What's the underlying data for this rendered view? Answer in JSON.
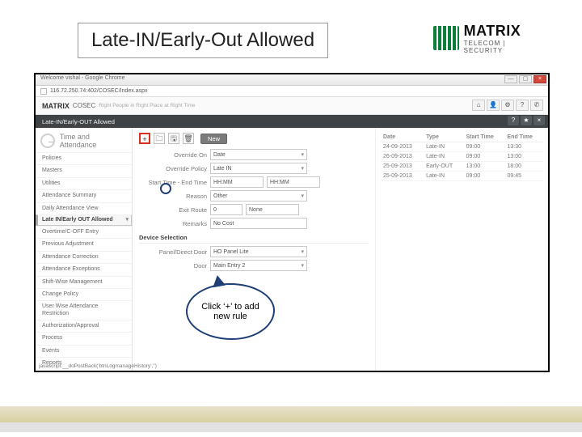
{
  "slide": {
    "title": "Late-IN/Early-Out Allowed"
  },
  "logo": {
    "text": "MATRIX",
    "sub": "TELECOM | SECURITY"
  },
  "browser": {
    "title": "Welcome vishal - Google Chrome",
    "url": "116.72.250.74:402/COSEC/Index.aspx"
  },
  "app": {
    "brand": "MATRIX",
    "product": "COSEC",
    "tagline": "Right People in Right Place at Right Time",
    "crumb": "Late-IN/Early-OUT Allowed",
    "header_icons": {
      "home": "⌂",
      "person": "👤",
      "gear": "⚙",
      "help": "?",
      "phone": "✆"
    },
    "crumb_icons": {
      "help": "?",
      "star": "★",
      "close": "×"
    }
  },
  "sidebar": {
    "module": "Time and Attendance",
    "groups": [
      "Policies",
      "Masters",
      "Utilities"
    ],
    "items": [
      "Attendance Summary",
      "Daily Attendance View",
      "Late IN/Early OUT Allowed",
      "Overtime/C-OFF Entry",
      "Previous Adjustment",
      "Attendance Correction",
      "Attendance Exceptions",
      "Shift-Wise Management",
      "Change Policy",
      "User Wise Attendance Restriction"
    ],
    "tail": [
      "Authorization/Approval",
      "Process",
      "Events",
      "Reports"
    ]
  },
  "toolbar": {
    "plus": "+",
    "open": "🗀",
    "save": "🖫",
    "trash": "🗑",
    "new_label": "New"
  },
  "form": {
    "override_on_l": "Override On",
    "override_on_v": "Date",
    "override_policy_l": "Override Policy",
    "override_policy_v": "Late IN",
    "time_l": "Start Time - End Time",
    "start_v": "HH:MM",
    "end_v": "HH:MM",
    "reason_l": "Reason",
    "reason_v": "Other",
    "exit_route_l": "Exit Route",
    "exit_route_id": "0",
    "exit_route_name": "None",
    "remarks_l": "Remarks",
    "remarks_v": "No Cost",
    "device_hdr": "Device Selection",
    "panel_door_l": "Panel/Direct Door",
    "panel_door_v": "HO Panel Lite",
    "door_l": "Door",
    "door_v": "Main Entry 2"
  },
  "list": {
    "cols": [
      "Date",
      "Type",
      "Start Time",
      "End Time"
    ],
    "rows": [
      [
        "24-09-2013",
        "Late-IN",
        "09:00",
        "13:30"
      ],
      [
        "26-09-2013",
        "Late-IN",
        "09:00",
        "13:00"
      ],
      [
        "25-09-2013",
        "Early-OUT",
        "13:00",
        "18:00"
      ],
      [
        "25-09-2013",
        "Late-IN",
        "09:00",
        "09:45"
      ]
    ]
  },
  "callout": "Click ‘+’ to add new rule",
  "status": "javascript:__doPostBack('btnLogmanageHistory','')"
}
